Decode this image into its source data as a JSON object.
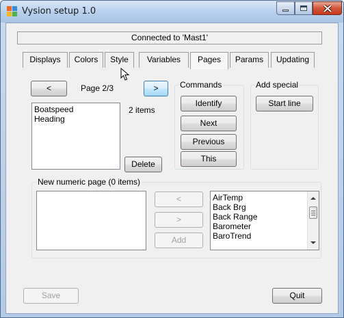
{
  "window": {
    "title": "Vysion setup 1.0",
    "icon": "app-icon",
    "controls": {
      "minimize": "minimize-icon",
      "maximize": "maximize-icon",
      "close": "close-icon"
    }
  },
  "status": {
    "connection": "Connected to 'Mast1'"
  },
  "tabs": [
    {
      "label": "Displays"
    },
    {
      "label": "Colors"
    },
    {
      "label": "Style"
    },
    {
      "label": "Variables"
    },
    {
      "label": "Pages"
    },
    {
      "label": "Params"
    },
    {
      "label": "Updating"
    }
  ],
  "active_tab": "Pages",
  "pages": {
    "prev_label": "<",
    "next_label": ">",
    "page_indicator": "Page 2/3",
    "items_count": "2 items",
    "list_items": [
      "Boatspeed",
      "Heading"
    ],
    "delete_label": "Delete"
  },
  "commands": {
    "title": "Commands",
    "buttons": [
      "Identify",
      "Next",
      "Previous",
      "This"
    ]
  },
  "add_special": {
    "title": "Add special",
    "start_line_label": "Start line"
  },
  "new_page": {
    "title": "New numeric page (0 items)",
    "left_label": "<",
    "right_label": ">",
    "add_label": "Add",
    "variables": [
      "AirTemp",
      "Back Brg",
      "Back Range",
      "Barometer",
      "BaroTrend"
    ]
  },
  "footer": {
    "save_label": "Save",
    "quit_label": "Quit"
  },
  "colors": {
    "accent": "#3c7fb1",
    "titlebar": "#bcd3ee",
    "close": "#c33a1f"
  }
}
